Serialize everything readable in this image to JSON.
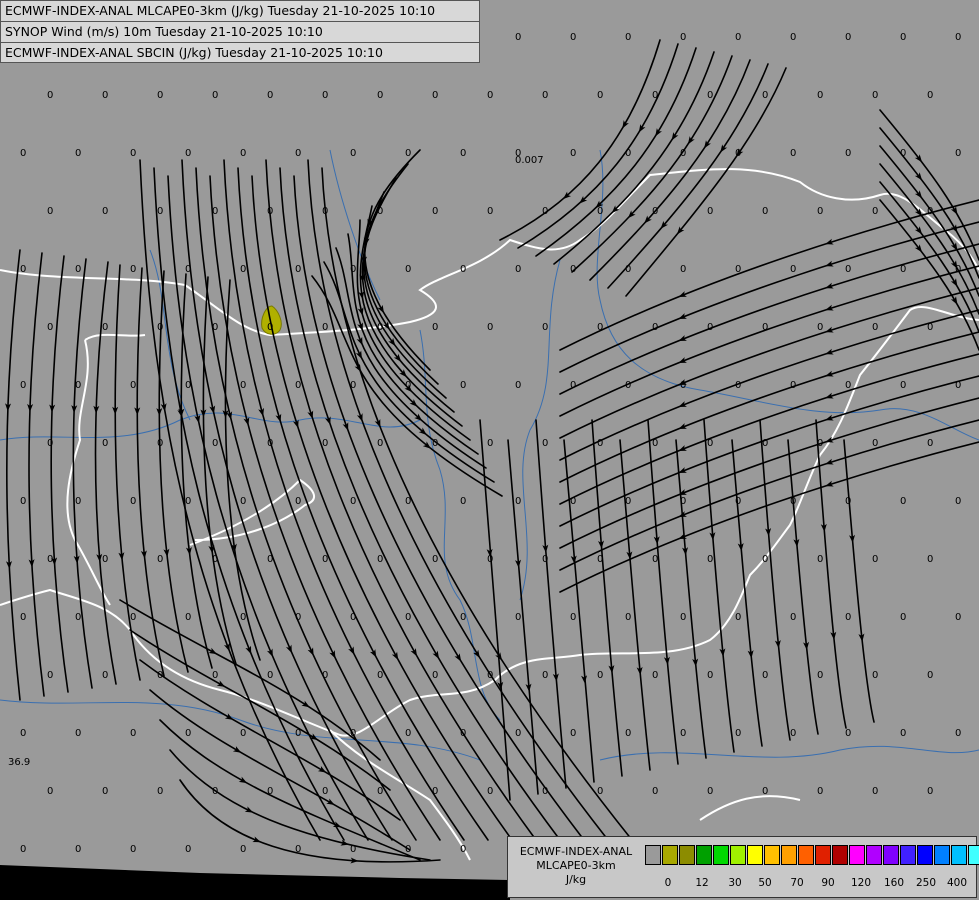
{
  "header": {
    "line1": "ECMWF-INDEX-ANAL MLCAPE0-3km (J/kg) Tuesday 21-10-2025 10:10",
    "line2": "SYNOP Wind (m/s) 10m Tuesday 21-10-2025 10:10",
    "line3": "ECMWF-INDEX-ANAL SBCIN (J/kg) Tuesday 21-10-2025 10:10"
  },
  "legend": {
    "title_line1": "ECMWF-INDEX-ANAL",
    "title_line2": "MLCAPE0-3km",
    "title_line3": "J/kg",
    "colors": [
      "#9a9a9a",
      "#a8a800",
      "#8c8c00",
      "#00a000",
      "#00d800",
      "#a0f000",
      "#ffff00",
      "#ffc000",
      "#ffa000",
      "#ff6000",
      "#e02000",
      "#b00000",
      "#ff00ff",
      "#b000ff",
      "#8000ff",
      "#4020ff",
      "#0000ff",
      "#0080ff",
      "#00c0ff",
      "#40ffff",
      "#a0ffff",
      "#ffffff"
    ],
    "ticks": [
      "0",
      "12",
      "30",
      "50",
      "70",
      "90",
      "120",
      "160",
      "250",
      "400"
    ]
  },
  "map_values": {
    "zero": "0",
    "special_1": "0.007",
    "special_2": "36.9"
  }
}
